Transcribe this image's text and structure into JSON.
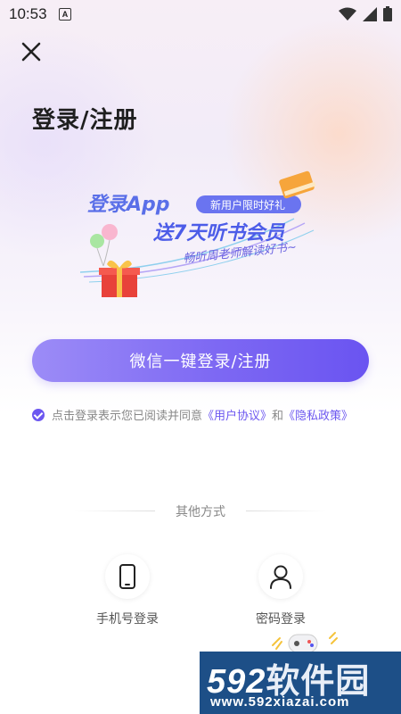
{
  "status": {
    "time": "10:53",
    "a_badge": "A"
  },
  "page": {
    "title": "登录/注册"
  },
  "promo": {
    "headline": "登录App",
    "tag": "新用户限时好礼",
    "offer": "送7天听书会员",
    "sub": "畅听周老师解读好书~"
  },
  "wechat_login": {
    "label": "微信一键登录/注册"
  },
  "agreement": {
    "prefix": "点击登录表示您已阅读并同意",
    "user_link": "《用户协议》",
    "and": "和",
    "privacy_link": "《隐私政策》"
  },
  "other": {
    "label": "其他方式",
    "options": [
      {
        "label": "手机号登录",
        "icon": "phone-icon"
      },
      {
        "label": "密码登录",
        "icon": "user-icon"
      }
    ]
  },
  "watermark": {
    "brand_num": "592",
    "brand_text": "软件园",
    "url": "www.592xiazai.com"
  },
  "colors": {
    "accent": "#6c57f0",
    "button_start": "#9c8cf7",
    "button_end": "#6a54f1"
  }
}
